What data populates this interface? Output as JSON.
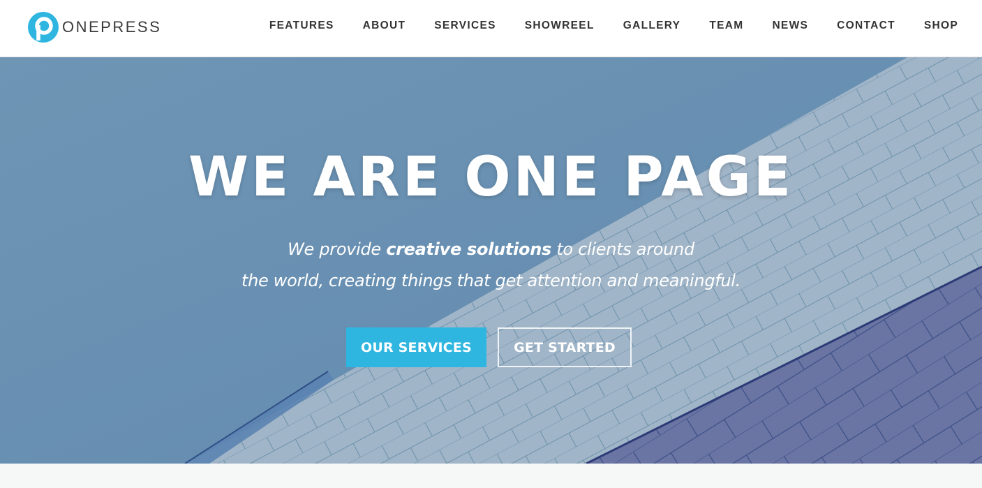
{
  "brand": {
    "name": "ONEPRESS",
    "accent_color": "#2fb6e0"
  },
  "nav": {
    "items": [
      {
        "label": "FEATURES"
      },
      {
        "label": "ABOUT"
      },
      {
        "label": "SERVICES"
      },
      {
        "label": "SHOWREEL"
      },
      {
        "label": "GALLERY"
      },
      {
        "label": "TEAM"
      },
      {
        "label": "NEWS"
      },
      {
        "label": "CONTACT"
      },
      {
        "label": "SHOP"
      }
    ]
  },
  "hero": {
    "title": "WE ARE ONE PAGE",
    "subtitle": {
      "line1_before": "We provide ",
      "line1_bold": "creative solutions",
      "line1_after": " to clients around",
      "line2": "the world, creating things that get attention and meaningful."
    },
    "primary_button": "OUR SERVICES",
    "secondary_button": "GET STARTED",
    "background_icon": "architecture-tiles-image"
  }
}
